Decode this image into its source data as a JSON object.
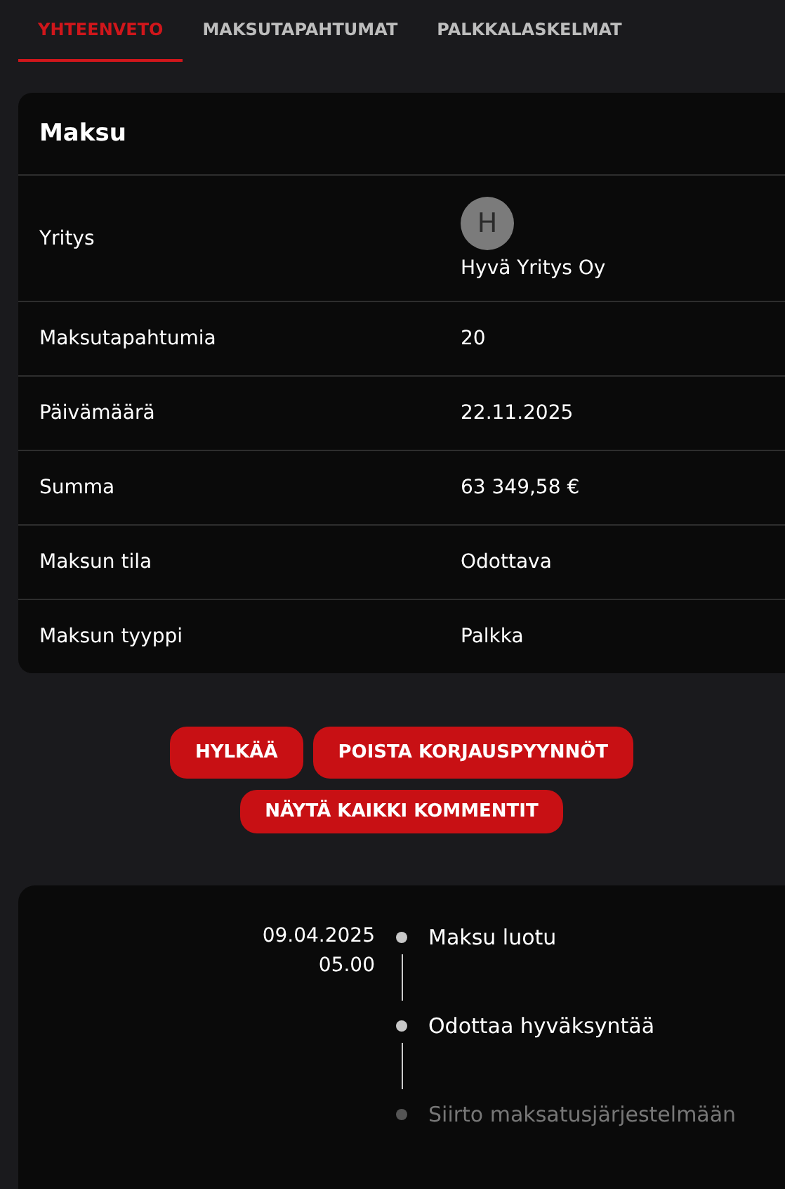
{
  "tabs": [
    {
      "label": "YHTEENVETO",
      "selected": true
    },
    {
      "label": "MAKSUTAPAHTUMAT",
      "selected": false
    },
    {
      "label": "PALKKALASKELMAT",
      "selected": false
    }
  ],
  "card": {
    "title": "Maksu",
    "rows": [
      {
        "label": "Yritys",
        "kind": "company",
        "avatar": "H",
        "value": "Hyvä Yritys Oy"
      },
      {
        "label": "Maksutapahtumia",
        "kind": "text",
        "value": "20"
      },
      {
        "label": "Päivämäärä",
        "kind": "text",
        "value": "22.11.2025"
      },
      {
        "label": "Summa",
        "kind": "text",
        "value": "63 349,58 €"
      },
      {
        "label": "Maksun tila",
        "kind": "text",
        "value": "Odottava"
      },
      {
        "label": "Maksun tyyppi",
        "kind": "text",
        "value": "Palkka"
      }
    ]
  },
  "buttons": [
    [
      "HYLKÄÄ",
      "POISTA KORJAUSPYYNNÖT"
    ],
    [
      "NÄYTÄ KAIKKI KOMMENTIT"
    ]
  ],
  "timeline": [
    {
      "date": "09.04.2025",
      "time": "05.00",
      "label": "Maksu luotu",
      "done": true
    },
    {
      "label": "Odottaa hyväksyntää",
      "done": true
    },
    {
      "label": "Siirto maksatusjärjestelmään",
      "done": false
    }
  ]
}
